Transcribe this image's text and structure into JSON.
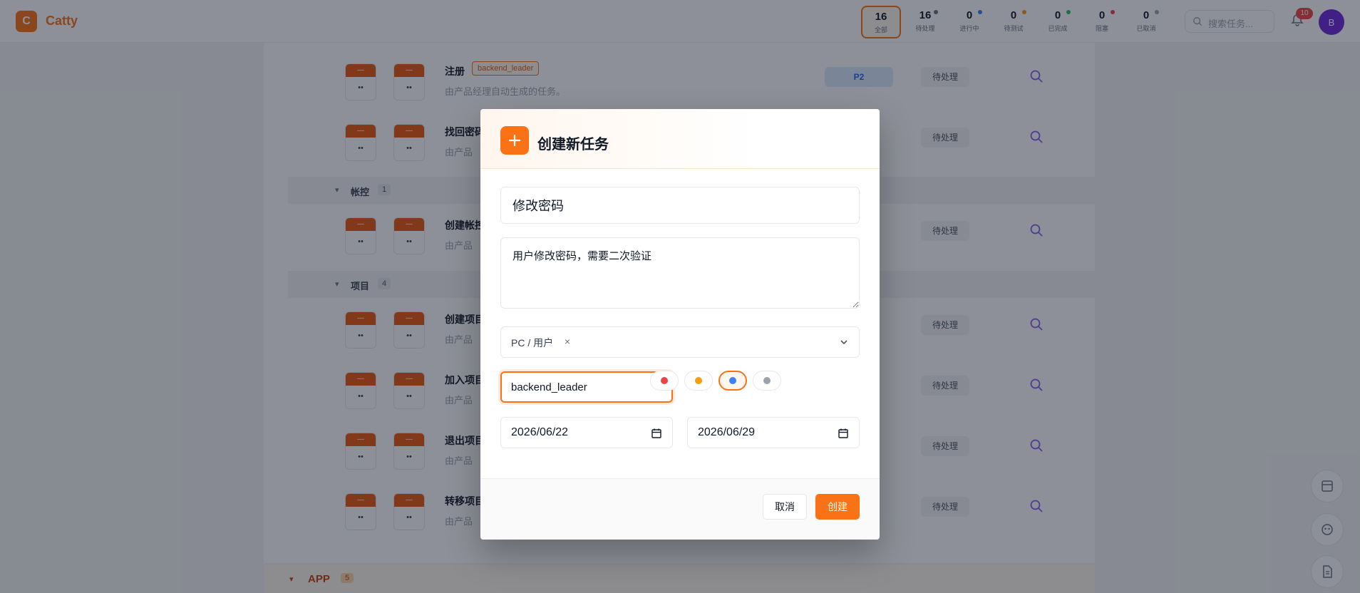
{
  "app": {
    "logo_letter": "C",
    "name": "Catty"
  },
  "stats": [
    {
      "value": "16",
      "label": "全部",
      "color": ""
    },
    {
      "value": "16",
      "label": "待处理",
      "color": "#6b7280"
    },
    {
      "value": "0",
      "label": "进行中",
      "color": "#3b82f6"
    },
    {
      "value": "0",
      "label": "待测试",
      "color": "#f59e0b"
    },
    {
      "value": "0",
      "label": "已完成",
      "color": "#22c55e"
    },
    {
      "value": "0",
      "label": "阻塞",
      "color": "#ef4444"
    },
    {
      "value": "0",
      "label": "已取消",
      "color": "#9ca3af"
    }
  ],
  "search": {
    "placeholder": "搜索任务..."
  },
  "notifications": {
    "count": "10"
  },
  "user": {
    "avatar_letter": "B"
  },
  "background": {
    "groups": [
      {
        "title": "帐控",
        "count": "1"
      },
      {
        "title": "项目",
        "count": "4"
      }
    ],
    "app_group": {
      "title": "APP",
      "count": "5"
    },
    "date_chip_top": "—",
    "date_chip_bottom": "••",
    "rows": [
      {
        "title": "注册",
        "tag": "backend_leader",
        "subtitle": "由产品经理自动生成的任务。",
        "priority": "P2",
        "status": "待处理"
      },
      {
        "title": "找回密码",
        "subtitle": "由产品",
        "status": "待处理"
      },
      {
        "title": "创建帐控",
        "subtitle": "由产品",
        "status": "待处理"
      },
      {
        "title": "创建项目",
        "subtitle": "由产品",
        "status": "待处理"
      },
      {
        "title": "加入项目",
        "subtitle": "由产品",
        "status": "待处理"
      },
      {
        "title": "退出项目",
        "subtitle": "由产品",
        "status": "待处理"
      },
      {
        "title": "转移项目",
        "subtitle": "由产品",
        "status": "待处理"
      }
    ]
  },
  "modal": {
    "title": "创建新任务",
    "task_title_value": "修改密码",
    "description_value": "用户修改密码，需要二次验证",
    "category_tag": "PC / 用户",
    "assignee_value": "backend_leader",
    "priority_colors": [
      "#ef4444",
      "#f59e0b",
      "#3b82f6",
      "#9ca3af"
    ],
    "priority_selected_index": 2,
    "start_date": "2026/06/22",
    "end_date": "2026/06/29",
    "cancel_label": "取消",
    "create_label": "创建"
  },
  "colors": {
    "accent": "#f97316"
  }
}
